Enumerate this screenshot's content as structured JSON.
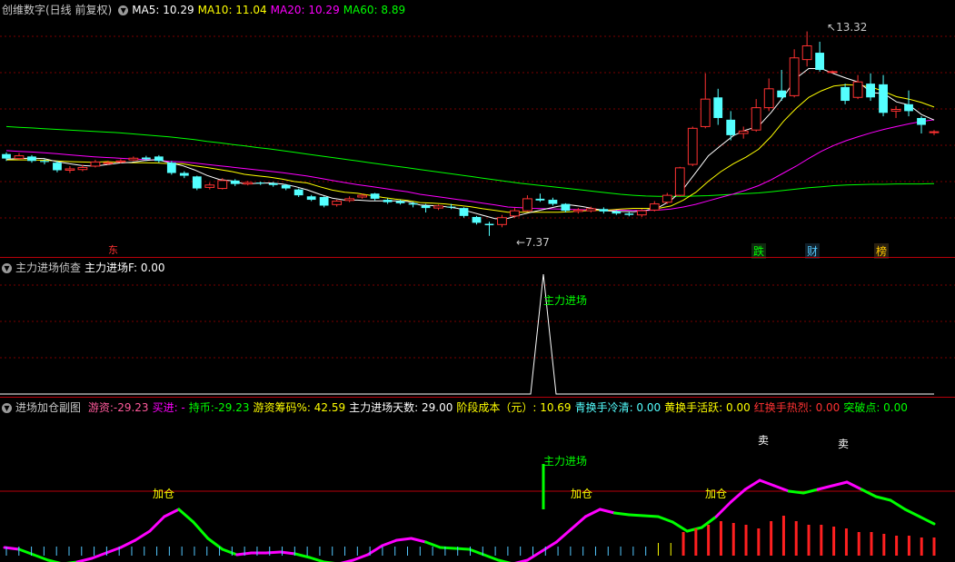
{
  "main": {
    "title": "创维数字(日线 前复权)",
    "ma5": "MA5: 10.29",
    "ma10": "MA10: 11.04",
    "ma20": "MA20: 10.29",
    "ma60": "MA60: 8.89",
    "high_label": "13.32",
    "low_label": "7.37",
    "marker_1": "东",
    "marker_2": "跌",
    "marker_3": "财",
    "marker_4": "榜",
    "colors": {
      "ma5": "#ffffff",
      "ma10": "#ffff00",
      "ma20": "#ff00ff",
      "ma60": "#00ff00",
      "up": "#ff3232",
      "down": "#54ffff"
    }
  },
  "p2": {
    "name": "主力进场侦查",
    "value": "主力进场F: 0.00",
    "peak_label": "主力进场"
  },
  "p3": {
    "name": "进场加仓副图",
    "items": [
      {
        "text": "游资:-29.23",
        "color": "#ff5a9c"
      },
      {
        "text": "买进: -",
        "color": "#ff00ff"
      },
      {
        "text": "持币:-29.23",
        "color": "#00ff00"
      },
      {
        "text": "游资筹码%: 42.59",
        "color": "#ffff00"
      },
      {
        "text": "主力进场天数: 29.00",
        "color": "#ffffff"
      },
      {
        "text": "阶段成本（元）: 10.69",
        "color": "#ffff00"
      },
      {
        "text": "青换手冷清: 0.00",
        "color": "#54ffff"
      },
      {
        "text": "黄换手活跃: 0.00",
        "color": "#ffff00"
      },
      {
        "text": "红换手热烈: 0.00",
        "color": "#ff3232"
      },
      {
        "text": "突破点: 0.00",
        "color": "#00ff00"
      }
    ],
    "signal_add_1": "加仓",
    "signal_add_2": "加仓",
    "signal_add_3": "加仓",
    "signal_enter": "主力进场",
    "signal_sell_1": "卖",
    "signal_sell_2": "卖"
  },
  "candles": [
    {
      "o": 9.75,
      "c": 9.62,
      "h": 9.8,
      "l": 9.55
    },
    {
      "o": 9.62,
      "c": 9.7,
      "h": 9.78,
      "l": 9.58
    },
    {
      "o": 9.68,
      "c": 9.55,
      "h": 9.72,
      "l": 9.5
    },
    {
      "o": 9.55,
      "c": 9.52,
      "h": 9.6,
      "l": 9.45
    },
    {
      "o": 9.5,
      "c": 9.28,
      "h": 9.55,
      "l": 9.22
    },
    {
      "o": 9.28,
      "c": 9.32,
      "h": 9.4,
      "l": 9.2
    },
    {
      "o": 9.3,
      "c": 9.36,
      "h": 9.44,
      "l": 9.25
    },
    {
      "o": 9.4,
      "c": 9.52,
      "h": 9.58,
      "l": 9.36
    },
    {
      "o": 9.5,
      "c": 9.5,
      "h": 9.56,
      "l": 9.44
    },
    {
      "o": 9.52,
      "c": 9.55,
      "h": 9.6,
      "l": 9.48
    },
    {
      "o": 9.58,
      "c": 9.63,
      "h": 9.68,
      "l": 9.55
    },
    {
      "o": 9.65,
      "c": 9.6,
      "h": 9.7,
      "l": 9.55
    },
    {
      "o": 9.68,
      "c": 9.55,
      "h": 9.72,
      "l": 9.5
    },
    {
      "o": 9.5,
      "c": 9.2,
      "h": 9.55,
      "l": 9.15
    },
    {
      "o": 9.2,
      "c": 9.12,
      "h": 9.25,
      "l": 9.05
    },
    {
      "o": 9.1,
      "c": 8.75,
      "h": 9.12,
      "l": 8.7
    },
    {
      "o": 8.78,
      "c": 8.85,
      "h": 8.92,
      "l": 8.72
    },
    {
      "o": 8.75,
      "c": 8.98,
      "h": 9.05,
      "l": 8.72
    },
    {
      "o": 8.98,
      "c": 8.88,
      "h": 9.02,
      "l": 8.82
    },
    {
      "o": 8.88,
      "c": 8.92,
      "h": 8.97,
      "l": 8.84
    },
    {
      "o": 8.92,
      "c": 8.9,
      "h": 8.95,
      "l": 8.85
    },
    {
      "o": 8.9,
      "c": 8.85,
      "h": 8.94,
      "l": 8.8
    },
    {
      "o": 8.85,
      "c": 8.75,
      "h": 8.88,
      "l": 8.7
    },
    {
      "o": 8.72,
      "c": 8.55,
      "h": 8.75,
      "l": 8.5
    },
    {
      "o": 8.52,
      "c": 8.42,
      "h": 8.56,
      "l": 8.38
    },
    {
      "o": 8.5,
      "c": 8.25,
      "h": 8.52,
      "l": 8.2
    },
    {
      "o": 8.28,
      "c": 8.38,
      "h": 8.42,
      "l": 8.22
    },
    {
      "o": 8.4,
      "c": 8.45,
      "h": 8.52,
      "l": 8.35
    },
    {
      "o": 8.5,
      "c": 8.55,
      "h": 8.6,
      "l": 8.45
    },
    {
      "o": 8.6,
      "c": 8.45,
      "h": 8.62,
      "l": 8.4
    },
    {
      "o": 8.42,
      "c": 8.35,
      "h": 8.46,
      "l": 8.3
    },
    {
      "o": 8.38,
      "c": 8.32,
      "h": 8.42,
      "l": 8.28
    },
    {
      "o": 8.32,
      "c": 8.28,
      "h": 8.36,
      "l": 8.2
    },
    {
      "o": 8.25,
      "c": 8.18,
      "h": 8.3,
      "l": 8.05
    },
    {
      "o": 8.18,
      "c": 8.24,
      "h": 8.28,
      "l": 8.12
    },
    {
      "o": 8.22,
      "c": 8.2,
      "h": 8.3,
      "l": 8.15
    },
    {
      "o": 8.18,
      "c": 7.95,
      "h": 8.2,
      "l": 7.9
    },
    {
      "o": 7.92,
      "c": 7.75,
      "h": 7.95,
      "l": 7.7
    },
    {
      "o": 7.72,
      "c": 7.68,
      "h": 7.78,
      "l": 7.37
    },
    {
      "o": 7.7,
      "c": 7.9,
      "h": 7.98,
      "l": 7.62
    },
    {
      "o": 7.95,
      "c": 8.1,
      "h": 8.18,
      "l": 7.9
    },
    {
      "o": 8.1,
      "c": 8.45,
      "h": 8.55,
      "l": 8.08
    },
    {
      "o": 8.45,
      "c": 8.4,
      "h": 8.6,
      "l": 8.36
    },
    {
      "o": 8.42,
      "c": 8.3,
      "h": 8.48,
      "l": 8.25
    },
    {
      "o": 8.3,
      "c": 8.1,
      "h": 8.32,
      "l": 8.05
    },
    {
      "o": 8.08,
      "c": 8.12,
      "h": 8.18,
      "l": 8.02
    },
    {
      "o": 8.1,
      "c": 8.16,
      "h": 8.22,
      "l": 8.05
    },
    {
      "o": 8.15,
      "c": 8.08,
      "h": 8.2,
      "l": 8.02
    },
    {
      "o": 8.08,
      "c": 8.02,
      "h": 8.12,
      "l": 7.98
    },
    {
      "o": 8.02,
      "c": 7.98,
      "h": 8.06,
      "l": 7.94
    },
    {
      "o": 7.98,
      "c": 8.1,
      "h": 8.15,
      "l": 7.92
    },
    {
      "o": 8.12,
      "c": 8.3,
      "h": 8.38,
      "l": 8.08
    },
    {
      "o": 8.35,
      "c": 8.55,
      "h": 8.62,
      "l": 8.3
    },
    {
      "o": 8.55,
      "c": 9.35,
      "h": 9.38,
      "l": 8.52
    },
    {
      "o": 9.45,
      "c": 10.5,
      "h": 10.55,
      "l": 9.4
    },
    {
      "o": 10.55,
      "c": 11.35,
      "h": 12.1,
      "l": 10.5
    },
    {
      "o": 11.4,
      "c": 10.8,
      "h": 11.65,
      "l": 10.6
    },
    {
      "o": 10.75,
      "c": 10.3,
      "h": 11.0,
      "l": 10.15
    },
    {
      "o": 10.35,
      "c": 10.42,
      "h": 10.55,
      "l": 10.2
    },
    {
      "o": 10.45,
      "c": 11.1,
      "h": 11.35,
      "l": 10.4
    },
    {
      "o": 11.1,
      "c": 11.65,
      "h": 11.95,
      "l": 11.0
    },
    {
      "o": 11.6,
      "c": 11.4,
      "h": 12.2,
      "l": 11.3
    },
    {
      "o": 11.45,
      "c": 12.55,
      "h": 12.8,
      "l": 11.4
    },
    {
      "o": 12.5,
      "c": 12.9,
      "h": 13.32,
      "l": 12.3
    },
    {
      "o": 12.7,
      "c": 12.2,
      "h": 13.02,
      "l": 12.15
    },
    {
      "o": 12.15,
      "c": 12.15,
      "h": 12.18,
      "l": 12.1
    },
    {
      "o": 11.7,
      "c": 11.3,
      "h": 11.8,
      "l": 11.2
    },
    {
      "o": 11.4,
      "c": 11.85,
      "h": 12.05,
      "l": 11.35
    },
    {
      "o": 11.8,
      "c": 11.4,
      "h": 12.1,
      "l": 11.3
    },
    {
      "o": 11.78,
      "c": 10.95,
      "h": 12.05,
      "l": 10.85
    },
    {
      "o": 11.0,
      "c": 11.05,
      "h": 11.15,
      "l": 10.8
    },
    {
      "o": 11.2,
      "c": 11.0,
      "h": 11.6,
      "l": 10.85
    },
    {
      "o": 10.8,
      "c": 10.6,
      "h": 10.85,
      "l": 10.35
    },
    {
      "o": 10.4,
      "c": 10.4,
      "h": 10.45,
      "l": 10.3
    }
  ],
  "ma5": [
    9.6,
    9.62,
    9.63,
    9.62,
    9.53,
    9.47,
    9.42,
    9.4,
    9.44,
    9.49,
    9.51,
    9.56,
    9.59,
    9.5,
    9.42,
    9.29,
    9.13,
    9.01,
    8.97,
    8.88,
    8.9,
    8.91,
    8.88,
    8.81,
    8.71,
    8.58,
    8.47,
    8.41,
    8.41,
    8.39,
    8.39,
    8.39,
    8.37,
    8.27,
    8.25,
    8.22,
    8.17,
    8.07,
    7.97,
    7.87,
    7.88,
    7.98,
    8.07,
    8.15,
    8.23,
    8.27,
    8.22,
    8.15,
    8.1,
    8.08,
    8.07,
    8.11,
    8.19,
    8.4,
    8.74,
    9.22,
    9.7,
    10.0,
    10.29,
    10.45,
    10.56,
    10.96,
    11.42,
    11.96,
    12.24,
    12.24,
    12.09,
    11.96,
    11.84,
    11.54,
    11.51,
    11.27,
    11.18,
    10.9,
    10.74
  ],
  "ma10": [
    9.58,
    9.58,
    9.58,
    9.57,
    9.55,
    9.53,
    9.52,
    9.51,
    9.53,
    9.51,
    9.5,
    9.5,
    9.49,
    9.47,
    9.47,
    9.41,
    9.36,
    9.3,
    9.24,
    9.16,
    9.12,
    9.08,
    9.02,
    8.95,
    8.91,
    8.8,
    8.7,
    8.64,
    8.61,
    8.55,
    8.49,
    8.44,
    8.4,
    8.34,
    8.32,
    8.3,
    8.26,
    8.22,
    8.16,
    8.11,
    8.06,
    8.06,
    8.06,
    8.06,
    8.06,
    8.07,
    8.1,
    8.11,
    8.12,
    8.15,
    8.17,
    8.17,
    8.17,
    8.24,
    8.41,
    8.64,
    8.96,
    9.24,
    9.47,
    9.66,
    9.89,
    10.26,
    10.71,
    11.08,
    11.4,
    11.59,
    11.73,
    11.77,
    11.75,
    11.7,
    11.57,
    11.42,
    11.35,
    11.25,
    11.12
  ],
  "ma20": [
    9.85,
    9.83,
    9.81,
    9.79,
    9.76,
    9.73,
    9.7,
    9.67,
    9.65,
    9.63,
    9.61,
    9.59,
    9.57,
    9.54,
    9.52,
    9.49,
    9.45,
    9.41,
    9.37,
    9.33,
    9.29,
    9.25,
    9.21,
    9.16,
    9.11,
    9.05,
    8.98,
    8.92,
    8.86,
    8.81,
    8.76,
    8.7,
    8.65,
    8.58,
    8.53,
    8.48,
    8.43,
    8.38,
    8.32,
    8.27,
    8.21,
    8.19,
    8.17,
    8.16,
    8.15,
    8.14,
    8.13,
    8.13,
    8.12,
    8.12,
    8.11,
    8.11,
    8.12,
    8.15,
    8.21,
    8.29,
    8.39,
    8.49,
    8.59,
    8.7,
    8.83,
    9.0,
    9.2,
    9.4,
    9.62,
    9.83,
    10.0,
    10.14,
    10.26,
    10.37,
    10.47,
    10.55,
    10.63,
    10.7,
    10.75
  ],
  "ma60": [
    10.55,
    10.53,
    10.51,
    10.49,
    10.47,
    10.45,
    10.43,
    10.41,
    10.39,
    10.37,
    10.34,
    10.31,
    10.28,
    10.25,
    10.21,
    10.17,
    10.12,
    10.08,
    10.03,
    9.99,
    9.94,
    9.9,
    9.85,
    9.8,
    9.75,
    9.7,
    9.65,
    9.6,
    9.55,
    9.5,
    9.45,
    9.4,
    9.35,
    9.3,
    9.25,
    9.2,
    9.15,
    9.1,
    9.05,
    9.0,
    8.95,
    8.9,
    8.86,
    8.82,
    8.78,
    8.74,
    8.7,
    8.66,
    8.62,
    8.58,
    8.55,
    8.53,
    8.52,
    8.52,
    8.52,
    8.53,
    8.54,
    8.56,
    8.58,
    8.6,
    8.62,
    8.65,
    8.69,
    8.73,
    8.77,
    8.8,
    8.83,
    8.85,
    8.86,
    8.87,
    8.87,
    8.88,
    8.88,
    8.88,
    8.89
  ],
  "p3_line": [
    -62,
    -64,
    -70,
    -76,
    -80,
    -78,
    -74,
    -68,
    -62,
    -54,
    -44,
    -28,
    -20,
    -34,
    -52,
    -64,
    -70,
    -68,
    -68,
    -67,
    -69,
    -73,
    -78,
    -80,
    -76,
    -70,
    -60,
    -54,
    -52,
    -56,
    -62,
    -63,
    -64,
    -70,
    -76,
    -80,
    -76,
    -66,
    -56,
    -42,
    -28,
    -20,
    -24,
    -26,
    -27,
    -28,
    -34,
    -44,
    -40,
    -28,
    -12,
    2,
    12,
    6,
    0,
    -2,
    2,
    6,
    10,
    2,
    -6,
    -10,
    -20,
    -28,
    -36
  ],
  "p3_pink_mask": [
    1,
    0,
    0,
    0,
    0,
    1,
    1,
    1,
    1,
    1,
    1,
    1,
    0,
    0,
    0,
    0,
    1,
    1,
    1,
    1,
    0,
    0,
    0,
    1,
    1,
    1,
    1,
    1,
    1,
    0,
    0,
    0,
    0,
    0,
    0,
    1,
    1,
    1,
    1,
    1,
    1,
    1,
    0,
    0,
    0,
    0,
    0,
    0,
    0,
    1,
    1,
    1,
    1,
    1,
    0,
    0,
    1,
    1,
    1,
    0,
    0,
    0,
    0,
    0,
    0
  ],
  "p3_vol": [
    1,
    1,
    1,
    1,
    1,
    1,
    1,
    1,
    1,
    1,
    1,
    1,
    1,
    1,
    1,
    1,
    1,
    1,
    1,
    1,
    1,
    1,
    1,
    1,
    1,
    1,
    1,
    1,
    1,
    1,
    1,
    1,
    1,
    1,
    1,
    1,
    1,
    1,
    1,
    1,
    1,
    1,
    1,
    1,
    1,
    1,
    1,
    1,
    1,
    1,
    1,
    1,
    2,
    2,
    3,
    3,
    3,
    3,
    3,
    3,
    3,
    3,
    3,
    3,
    3,
    3,
    3,
    3,
    3,
    3,
    3,
    3,
    3,
    3,
    3
  ],
  "p3_vol_h": [
    10,
    10,
    10,
    10,
    10,
    10,
    10,
    10,
    10,
    10,
    10,
    10,
    10,
    10,
    10,
    10,
    10,
    10,
    10,
    10,
    10,
    10,
    10,
    10,
    10,
    10,
    10,
    10,
    10,
    10,
    10,
    10,
    10,
    10,
    10,
    10,
    10,
    10,
    10,
    10,
    10,
    10,
    10,
    10,
    10,
    10,
    10,
    10,
    10,
    10,
    10,
    10,
    14,
    14,
    26,
    30,
    34,
    38,
    36,
    34,
    30,
    38,
    44,
    38,
    34,
    34,
    32,
    30,
    26,
    26,
    24,
    22,
    22,
    20,
    20
  ]
}
